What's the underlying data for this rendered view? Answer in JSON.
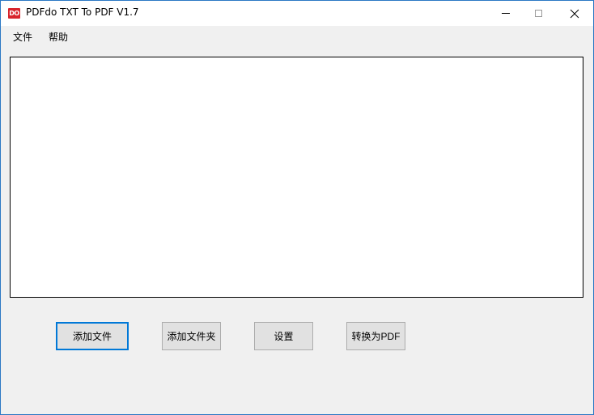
{
  "window": {
    "title": "PDFdo TXT To PDF V1.7",
    "icon_text": "DO",
    "icon": "pdfdo-app-icon",
    "accent_color": "#d8242c",
    "border_color": "#2b78c4"
  },
  "menu": {
    "items": [
      {
        "label": "文件"
      },
      {
        "label": "帮助"
      }
    ]
  },
  "buttons": {
    "add_file": "添加文件",
    "add_folder": "添加文件夹",
    "settings": "设置",
    "convert": "转换为PDF"
  }
}
